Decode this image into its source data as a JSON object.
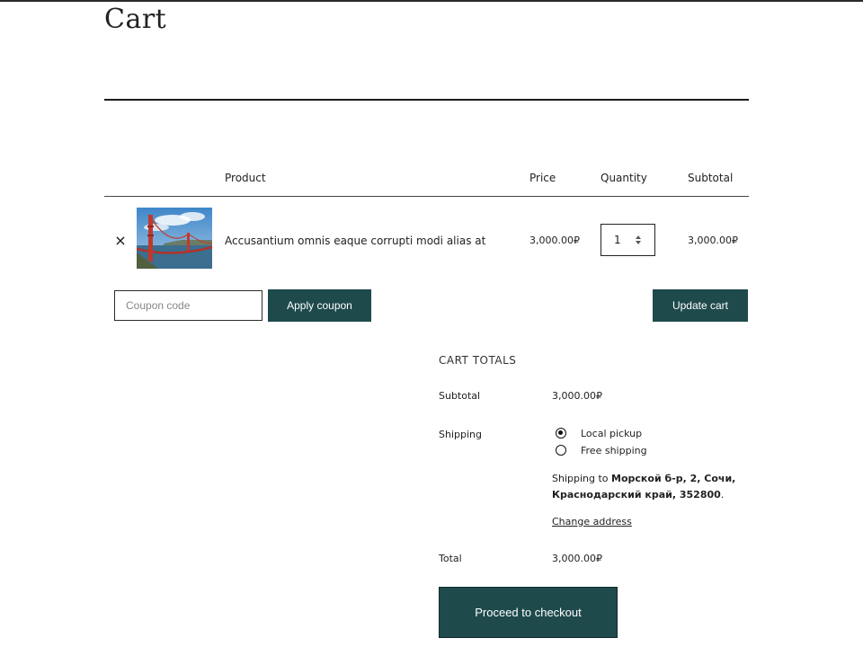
{
  "page": {
    "title": "Cart"
  },
  "cart_table": {
    "headers": {
      "product": "Product",
      "price": "Price",
      "quantity": "Quantity",
      "subtotal": "Subtotal"
    },
    "items": [
      {
        "remove_icon": "×",
        "name": "Accusantium omnis eaque corrupti modi alias at",
        "price": "3,000.00₽",
        "quantity": "1",
        "subtotal": "3,000.00₽",
        "image": "golden-gate-bridge-photo"
      }
    ]
  },
  "actions": {
    "coupon_placeholder": "Coupon code",
    "apply_coupon": "Apply coupon",
    "update_cart": "Update cart"
  },
  "totals": {
    "heading": "CART TOTALS",
    "subtotal_label": "Subtotal",
    "subtotal_value": "3,000.00₽",
    "shipping_label": "Shipping",
    "shipping_options": [
      {
        "label": "Local pickup",
        "selected": true
      },
      {
        "label": "Free shipping",
        "selected": false
      }
    ],
    "shipping_to_prefix": "Shipping to",
    "shipping_address": "Морской б-р, 2, Сочи, Краснодарский край, 352800",
    "shipping_to_suffix": ".",
    "change_address": "Change address",
    "total_label": "Total",
    "total_value": "3,000.00₽",
    "checkout_label": "Proceed to checkout"
  },
  "colors": {
    "button_bg": "#1f4a4c",
    "button_text": "#ffffff",
    "text": "#1e1e1e"
  }
}
